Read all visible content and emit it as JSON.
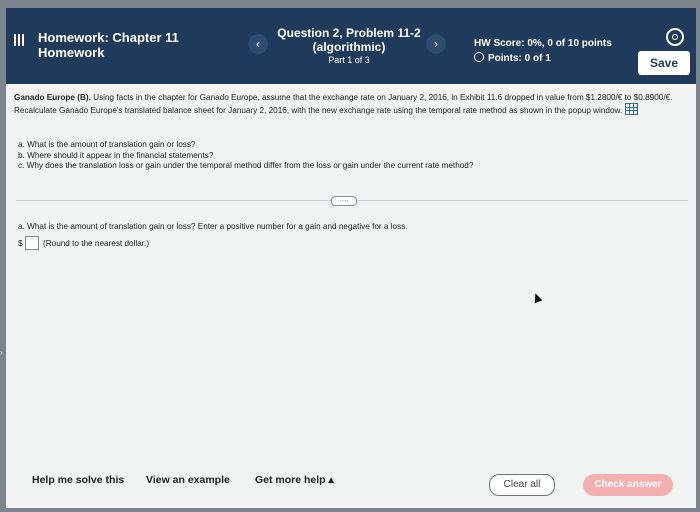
{
  "header": {
    "hw_label": "Homework:",
    "hw_chapter": "Chapter 11",
    "hw_sub": "Homework",
    "prev_label": "‹",
    "next_label": "›",
    "question_title": "Question 2, Problem 11-2",
    "question_sub": "(algorithmic)",
    "part": "Part 1 of 3",
    "hw_score": "HW Score: 0%, 0 of 10 points",
    "points": "Points: 0 of 1",
    "save_label": "Save"
  },
  "problem": {
    "company": "Ganado Europe (B).",
    "text": "Using facts in the chapter for Ganado Europe, assume that the exchange rate on January 2, 2016, in Exhibit 11.6 dropped in value from $1.2800/€ to $0.8900/€. Recalculate Ganado Europe's translated balance sheet for January 2, 2016, with the new exchange rate using the temporal rate method as shown in the popup window.",
    "q_a": "a. What is the amount of translation gain or loss?",
    "q_b": "b. Where should it appear in the financial statements?",
    "q_c": "c. Why does the translation loss or gain under the temporal method differ from the loss or gain under the current rate method?",
    "expand_label": "....."
  },
  "part_a": {
    "prompt": "a. What is the amount of translation gain or loss? Enter a positive number for a gain and negative for a loss.",
    "currency": "$",
    "input_value": "",
    "hint": "(Round to the nearest dollar.)"
  },
  "footer": {
    "help_label": "Help me solve this",
    "example_label": "View an example",
    "more_help_label": "Get more help ▴",
    "clear_label": "Clear all",
    "check_label": "Check answer"
  },
  "colors": {
    "header_bg": "#1f3a5a",
    "check_button": "#f4b0b0"
  }
}
